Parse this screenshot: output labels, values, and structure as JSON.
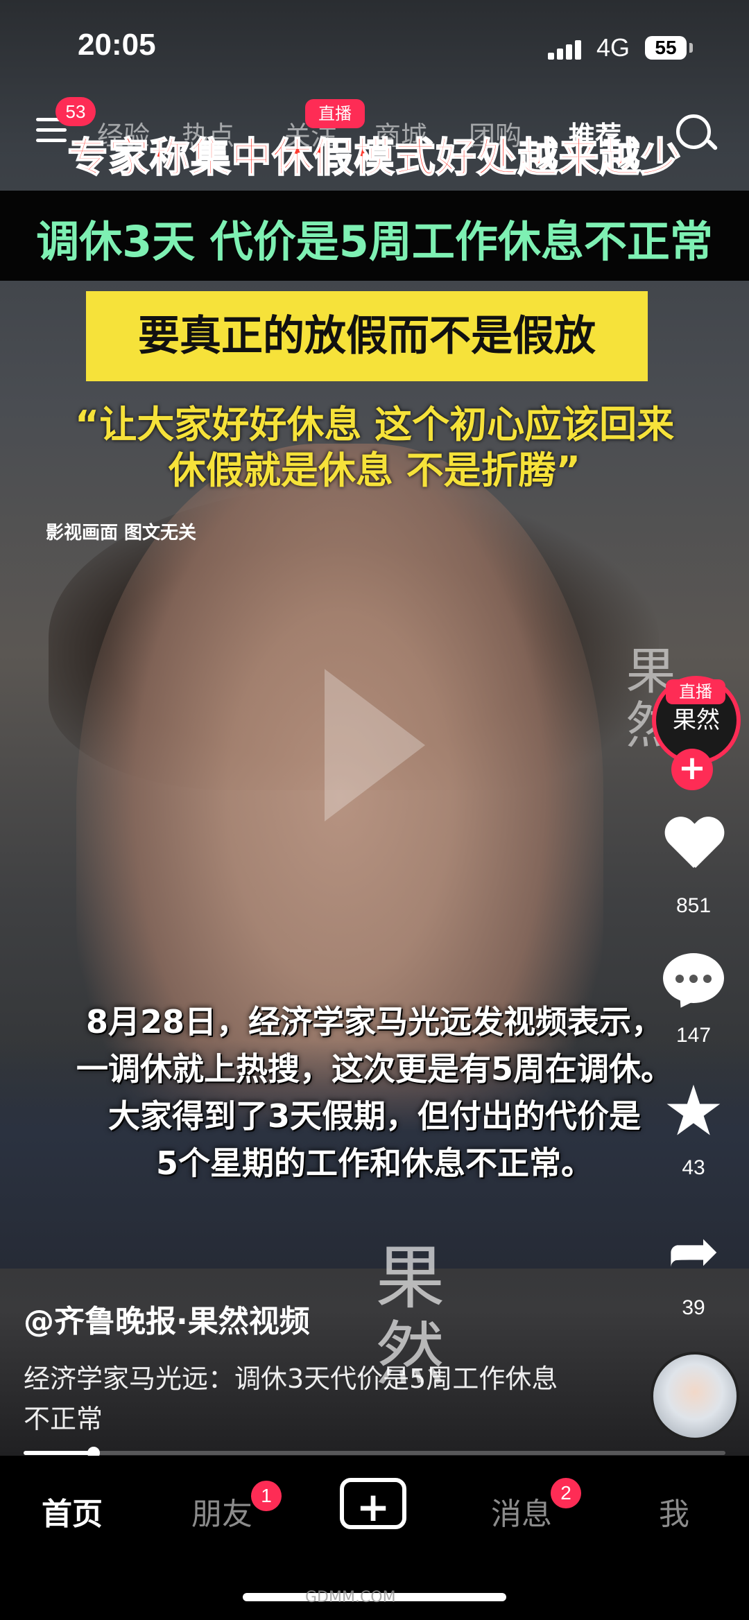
{
  "status_bar": {
    "time": "20:05",
    "network": "4G",
    "battery": "55"
  },
  "top_nav": {
    "menu_badge": "53",
    "tabs": [
      "经验",
      "热点",
      "关注",
      "商城",
      "团购",
      "推荐"
    ],
    "live_label": "直播"
  },
  "video": {
    "headline_red": "专家称集中休假模式好处越来越少",
    "headline_green": "调休3天 代价是5周工作休息不正常",
    "yellow_banner": "要真正的放假而不是假放",
    "quote_line1": "“让大家好好休息 这个初心应该回来",
    "quote_line2": "休假就是休息 不是折腾”",
    "disclaimer": "影视画面 图文无关",
    "watermark": "果然",
    "caption_lines": [
      "8月28日，经济学家马光远发视频表示，",
      "一调休就上热搜，这次更是有5周在调休。",
      "大家得到了3天假期，但付出的代价是",
      "5个星期的工作和休息不正常。"
    ],
    "progress": 0.1
  },
  "side_actions": {
    "avatar_text": "果然",
    "avatar_live": "直播",
    "likes": "851",
    "comments": "147",
    "favorites": "43",
    "shares": "39"
  },
  "post": {
    "author": "@齐鲁晚报·果然视频",
    "description": "经济学家马光远：调休3天代价是5周工作休息不正常"
  },
  "bottom_tabs": {
    "home": "首页",
    "friends": "朋友",
    "friends_badge": "1",
    "create": "+",
    "messages": "消息",
    "messages_badge": "2",
    "me": "我"
  },
  "site_watermark": "GDMM.COM"
}
